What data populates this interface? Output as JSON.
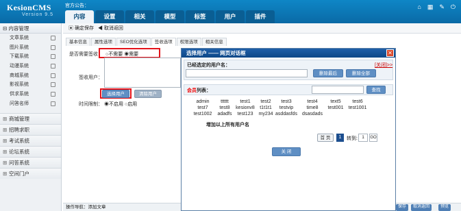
{
  "app": {
    "brand": "KesionCMS",
    "version": "Version 9.5",
    "notice": "官方公告："
  },
  "nav": {
    "tabs": [
      "内容",
      "设置",
      "相关",
      "模型",
      "标签",
      "用户",
      "插件"
    ]
  },
  "top_icons": [
    "home-icon",
    "grid-icon",
    "wrench-icon",
    "power-icon"
  ],
  "sidebar": {
    "header": "内容管理",
    "items": [
      "文章系统",
      "图片系统",
      "下载系统",
      "动漫系统",
      "商城系统",
      "影视系统",
      "供求系统",
      "问答名师"
    ],
    "sections": [
      "商城管理",
      "招聘求职",
      "考试系统",
      "论坛系统",
      "问答系统",
      "空间门户"
    ]
  },
  "toolbar": {
    "save": "确定保存",
    "cancel": "取消返回"
  },
  "subtabs": [
    "基本信息",
    "属性选项",
    "SEO优化选项",
    "签收选项",
    "权限选项",
    "相关信息"
  ],
  "form": {
    "need_sign_label": "是否需要签收：",
    "opt_no": "不需要",
    "opt_yes": "需要",
    "sign_user_label": "签收用户：",
    "select_user_btn": "选择用户",
    "clear_user_btn": "清除用户",
    "time_limit_label": "时间限制：",
    "time_no": "不启用",
    "time_yes": "启用"
  },
  "footer": {
    "nav_label": "操作导航：",
    "nav_value": "添加文章",
    "btns": [
      "保存",
      "取消返回",
      "预览"
    ]
  },
  "dialog": {
    "title": "选择用户 —— 网页对话框",
    "selected_label": "已经选定的用户名：",
    "help": "[关闭]>>",
    "del_last": "删除最后",
    "del_all": "删除全部",
    "list_prefix": "会员",
    "list_label": "列表：",
    "search": "查找",
    "users": [
      "admin",
      "tttttt",
      "test1",
      "test2",
      "test3",
      "test4",
      "text5",
      "test6",
      "test7",
      "test8",
      "kesionv8",
      "t1t1t1",
      "testvip",
      "time8",
      "test001",
      "test1001",
      "test1002",
      "adadfs",
      "test123",
      "my234",
      "asddasfds",
      "dsasdads"
    ],
    "add_all": "增加以上所有用户名",
    "pager": {
      "first": "首 页",
      "page": "1",
      "goto": "转到:",
      "page_input": "1",
      "go": "GO"
    },
    "close": "关 闭"
  }
}
